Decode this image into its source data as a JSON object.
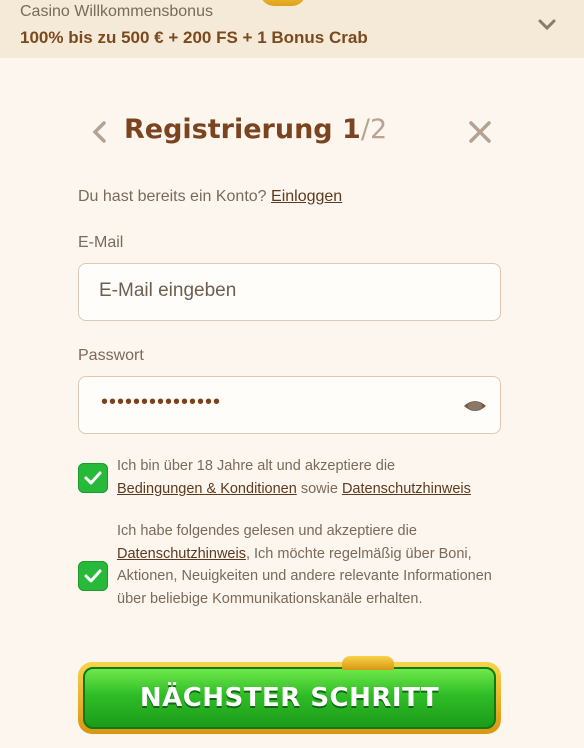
{
  "banner": {
    "title": "Casino Willkommensbonus",
    "offer": "100% bis zu 500 € + 200 FS + 1 Bonus Crab",
    "expand_icon": "chevron-down-icon"
  },
  "header": {
    "title": "Registrierung 1",
    "step_sep": "/",
    "step_total": "2",
    "back_icon": "chevron-left-icon",
    "close_icon": "close-icon"
  },
  "login": {
    "prompt": "Du hast bereits ein Konto?",
    "link": "Einloggen"
  },
  "form": {
    "email_label": "E-Mail",
    "email_placeholder": "E-Mail eingeben",
    "email_value": "",
    "password_label": "Passwort",
    "password_masked": "•••••••••••••••",
    "password_toggle_icon": "eye-icon"
  },
  "consents": [
    {
      "checked": true,
      "text_1": "Ich bin über 18 Jahre alt und akzeptiere die",
      "link_1": "Bedingungen & Konditionen",
      "text_2": "sowie",
      "link_2": "Datenschutzhinweis"
    },
    {
      "checked": true,
      "text_1": "Ich habe folgendes gelesen und akzeptiere die",
      "link_1": "Datenschutzhinweis",
      "text_2": ", Ich möchte regelmäßig über Boni, Aktionen, Neuigkeiten und andere relevante Informationen über beliebige Kommunikationskanäle erhalten."
    }
  ],
  "cta": {
    "label": "NÄCHSTER SCHRITT"
  },
  "colors": {
    "background": "#fdf6ee",
    "brand_brown": "#7a4420",
    "check_green": "#27b93a",
    "cta_green": "#2fbd26",
    "cta_gold": "#f8d44a"
  }
}
